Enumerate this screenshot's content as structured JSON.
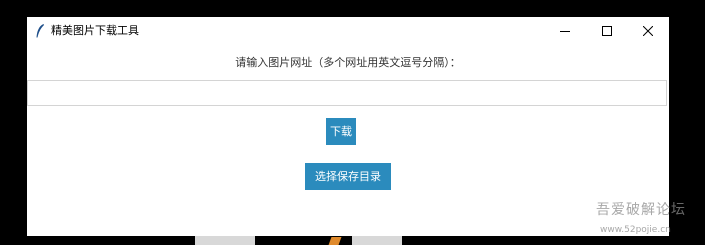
{
  "window": {
    "title": "精美图片下载工具",
    "controls": {
      "minimize_icon": "minimize-icon",
      "maximize_icon": "maximize-icon",
      "close_icon": "close-icon"
    }
  },
  "form": {
    "prompt": "请输入图片网址（多个网址用英文逗号分隔）：",
    "url_value": "",
    "download_label": "下载",
    "choose_dir_label": "选择保存目录"
  },
  "watermark": {
    "text": "吾爱破解论坛",
    "url": "www.52pojie.cn"
  },
  "colors": {
    "button_bg": "#2b8bbd",
    "button_text": "#ffffff",
    "window_bg": "#ffffff"
  }
}
